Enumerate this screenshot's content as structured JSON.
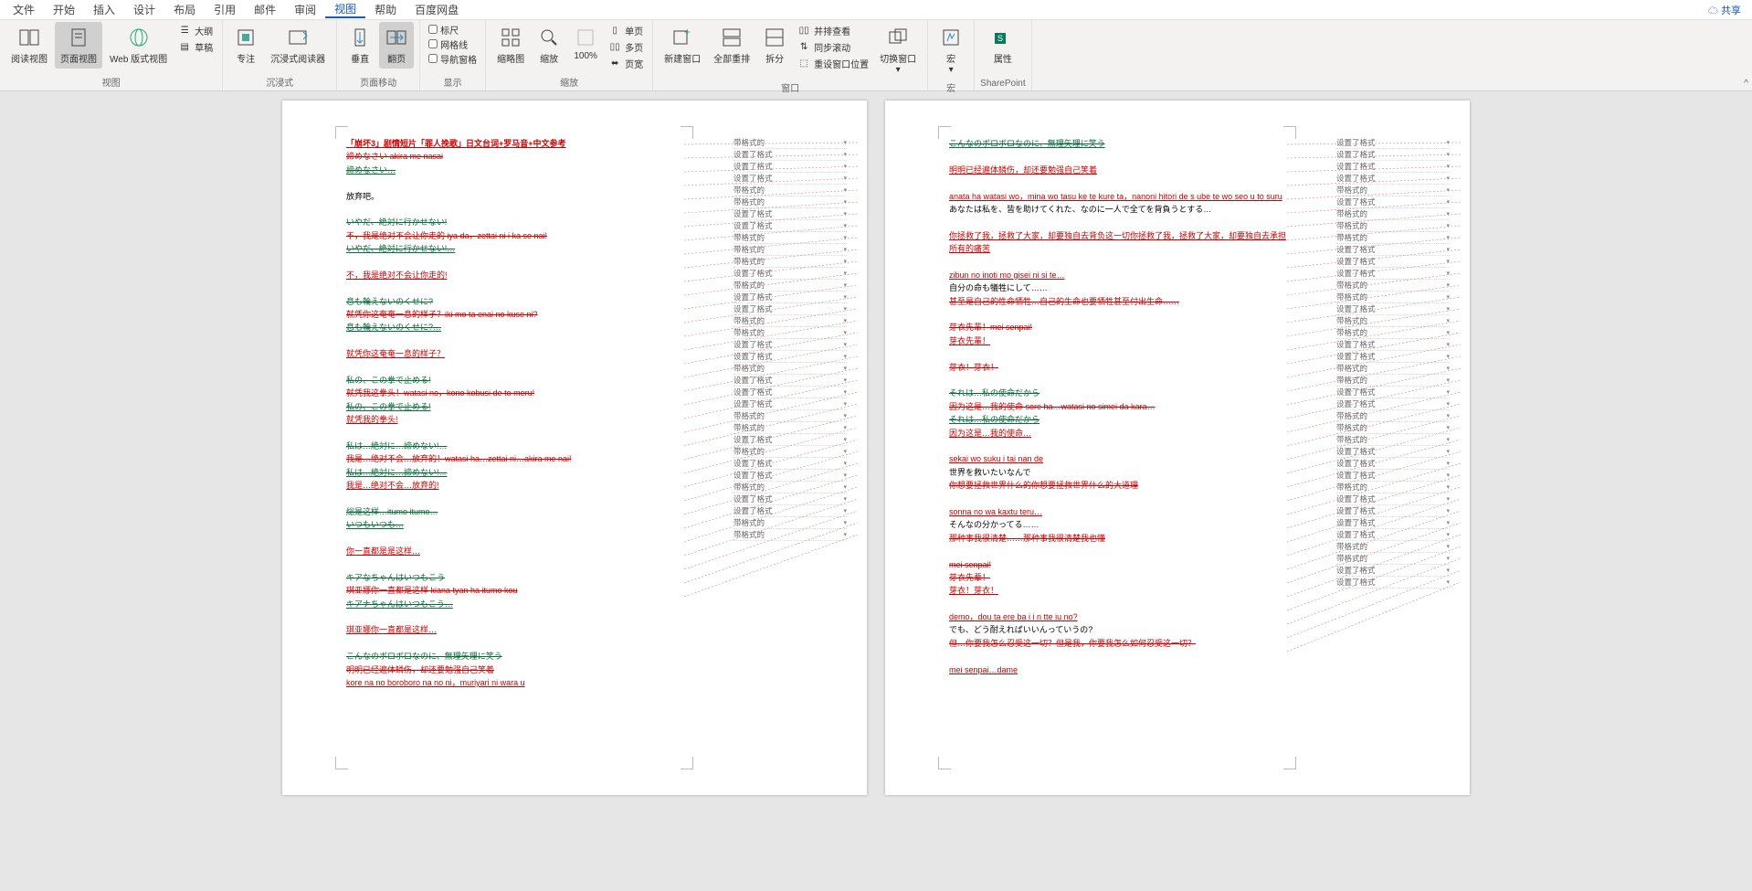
{
  "menu": {
    "items": [
      "文件",
      "开始",
      "插入",
      "设计",
      "布局",
      "引用",
      "邮件",
      "审阅",
      "视图",
      "帮助",
      "百度网盘"
    ],
    "active": 8,
    "share": "共享"
  },
  "ribbon": {
    "groups": [
      {
        "label": "视图",
        "btns": [
          {
            "n": "read",
            "t": "阅读视图"
          },
          {
            "n": "page",
            "t": "页面视图",
            "sel": true
          },
          {
            "n": "web",
            "t": "Web 版式视图"
          }
        ],
        "side": [
          {
            "n": "outline",
            "t": "大纲"
          },
          {
            "n": "draft",
            "t": "草稿"
          }
        ]
      },
      {
        "label": "沉浸式",
        "btns": [
          {
            "n": "focus",
            "t": "专注"
          },
          {
            "n": "reader",
            "t": "沉浸式阅读器"
          }
        ]
      },
      {
        "label": "页面移动",
        "btns": [
          {
            "n": "vert",
            "t": "垂直"
          },
          {
            "n": "flip",
            "t": "翻页",
            "sel": true
          }
        ]
      },
      {
        "label": "显示",
        "checks": [
          {
            "n": "ruler",
            "t": "标尺"
          },
          {
            "n": "grid",
            "t": "网格线"
          },
          {
            "n": "nav",
            "t": "导航窗格"
          }
        ]
      },
      {
        "label": "缩放",
        "btns": [
          {
            "n": "thumb",
            "t": "缩略图"
          },
          {
            "n": "zoom",
            "t": "缩放"
          },
          {
            "n": "z100",
            "t": "100%"
          }
        ],
        "side": [
          {
            "n": "onep",
            "t": "单页"
          },
          {
            "n": "multip",
            "t": "多页"
          },
          {
            "n": "pagew",
            "t": "页宽"
          }
        ]
      },
      {
        "label": "窗口",
        "btns": [
          {
            "n": "newwin",
            "t": "新建窗口"
          },
          {
            "n": "arrange",
            "t": "全部重排"
          },
          {
            "n": "split",
            "t": "拆分"
          }
        ],
        "side": [
          {
            "n": "sidebyside",
            "t": "并排查看"
          },
          {
            "n": "syncscroll",
            "t": "同步滚动"
          },
          {
            "n": "resetpos",
            "t": "重设窗口位置"
          }
        ],
        "extra": [
          {
            "n": "switch",
            "t": "切换窗口"
          }
        ]
      },
      {
        "label": "宏",
        "btns": [
          {
            "n": "macro",
            "t": "宏"
          }
        ]
      },
      {
        "label": "SharePoint",
        "btns": [
          {
            "n": "props",
            "t": "属性"
          }
        ]
      }
    ]
  },
  "revisions": {
    "fmt": "带格式的",
    "setfmt": "设置了格式"
  },
  "page1": {
    "title": "「崩坏3」剧情短片「罪人挽歌」日文台词+罗马音+中文参考",
    "lines": [
      {
        "c": "red del",
        "t": "諦めなさい akira me nasai"
      },
      {
        "c": "grn",
        "t": "諦めなさい…"
      },
      {
        "c": "blk",
        "t": ""
      },
      {
        "c": "blk",
        "t": "放弃吧。"
      },
      {
        "c": "blk",
        "t": ""
      },
      {
        "c": "grn del",
        "t": "いやだ、絶対に行かせない!"
      },
      {
        "c": "red del",
        "t": "不，我是绝对不会让你走的 iya da，zettai ni i ka se nai!"
      },
      {
        "c": "grn",
        "t": "いやだ、絶対に行かせない!…"
      },
      {
        "c": "blk",
        "t": ""
      },
      {
        "c": "red",
        "t": "不，我是绝对不会让你走的!"
      },
      {
        "c": "blk",
        "t": ""
      },
      {
        "c": "grn del",
        "t": "息も輪えないのくせに?"
      },
      {
        "c": "red del",
        "t": "就凭你这奄奄一息的样子？iki mo ta enai no kuse ni?"
      },
      {
        "c": "grn",
        "t": "息も輪えないのくせに?…"
      },
      {
        "c": "blk",
        "t": ""
      },
      {
        "c": "red",
        "t": "就凭你这奄奄一息的样子？"
      },
      {
        "c": "blk",
        "t": ""
      },
      {
        "c": "grn del",
        "t": "私の、この拳で止める!"
      },
      {
        "c": "red del",
        "t": "就凭我这拳头！watasi no，kono kobusi de to meru!"
      },
      {
        "c": "grn",
        "t": "私の、この拳で止める!"
      },
      {
        "c": "red",
        "t": "就凭我的拳头!"
      },
      {
        "c": "blk",
        "t": ""
      },
      {
        "c": "grn del",
        "t": "私は…絶対に…諦めない!…"
      },
      {
        "c": "red del",
        "t": "我是…绝对不会…放弃的！watasi ha…zettai ni…akira me nai!"
      },
      {
        "c": "grn",
        "t": "私は…絶対に…諦めない!…"
      },
      {
        "c": "red",
        "t": "我是…绝对不会…放弃的!"
      },
      {
        "c": "blk",
        "t": ""
      },
      {
        "c": "grn del",
        "t": "総是这样…itumo itumo…"
      },
      {
        "c": "grn",
        "t": "いつもいつも…"
      },
      {
        "c": "blk",
        "t": ""
      },
      {
        "c": "red",
        "t": "你一直都是是这样…"
      },
      {
        "c": "blk",
        "t": ""
      },
      {
        "c": "grn del",
        "t": "キアなちゃんはいつもこう"
      },
      {
        "c": "red del",
        "t": "琪亚娜你一直都是这样 kiana tyan ha itumo kou"
      },
      {
        "c": "grn",
        "t": "キアナちゃんはいつもこう…"
      },
      {
        "c": "blk",
        "t": ""
      },
      {
        "c": "red",
        "t": "琪亚娜你一直都是这样…"
      },
      {
        "c": "blk",
        "t": ""
      },
      {
        "c": "grn del",
        "t": "こんなのボロボロなのに、無理矢理に笑う"
      },
      {
        "c": "red del",
        "t": "明明已经遍体鳞伤，却还要勉强自己笑着"
      },
      {
        "c": "red",
        "t": "kore na no boroboro na no ni，muriyari ni wara u"
      }
    ],
    "revs": [
      "fmt",
      "setfmt",
      "setfmt",
      "setfmt",
      "fmt",
      "fmt",
      "setfmt",
      "setfmt",
      "fmt",
      "fmt",
      "fmt",
      "setfmt",
      "fmt",
      "setfmt",
      "setfmt",
      "fmt",
      "fmt",
      "setfmt",
      "setfmt",
      "fmt",
      "setfmt",
      "setfmt",
      "setfmt",
      "fmt",
      "fmt",
      "setfmt",
      "fmt",
      "setfmt",
      "setfmt",
      "fmt",
      "setfmt",
      "setfmt",
      "fmt",
      "fmt"
    ]
  },
  "page2": {
    "lines": [
      {
        "c": "grn",
        "t": "こんなのボロボロなのに、無理矢理に笑う"
      },
      {
        "c": "blk",
        "t": ""
      },
      {
        "c": "red",
        "t": "明明已经遍体鳞伤，却还要勉强自己笑着"
      },
      {
        "c": "blk",
        "t": ""
      },
      {
        "c": "red",
        "t": "anata ha watasi wo，mina wo tasu ke te kure ta，nanoni hitori de s ube te wo seo u to suru"
      },
      {
        "c": "blk",
        "t": "あなたは私を、皆を助けてくれた、なのに一人で全てを背負うとする…"
      },
      {
        "c": "blk",
        "t": ""
      },
      {
        "c": "red",
        "t": "你拯救了我，拯救了大家，却要独自去背负这一切你拯救了我，拯救了大家，却要独自去承担所有的痛苦"
      },
      {
        "c": "blk",
        "t": ""
      },
      {
        "c": "red",
        "t": "zibun no inoti mo gisei ni si te…"
      },
      {
        "c": "blk",
        "t": "自分の命も犠牲にして……"
      },
      {
        "c": "red del",
        "t": "甚至是自己的性命牺牲…自己的生命也要牺牲甚至付出生命……"
      },
      {
        "c": "blk",
        "t": ""
      },
      {
        "c": "red del",
        "t": "芽衣先輩！mei senpai!"
      },
      {
        "c": "red",
        "t": "芽衣先輩！"
      },
      {
        "c": "blk",
        "t": ""
      },
      {
        "c": "red del",
        "t": "芽衣！芽衣！"
      },
      {
        "c": "blk",
        "t": ""
      },
      {
        "c": "grn del",
        "t": "それは…私の使命だから"
      },
      {
        "c": "red del",
        "t": "因为这是…我的使命 sore ha…watasi no simei da kara…"
      },
      {
        "c": "grn",
        "t": "それは…私の使命だから"
      },
      {
        "c": "red",
        "t": "因为这是…我的使命…"
      },
      {
        "c": "blk",
        "t": ""
      },
      {
        "c": "red",
        "t": "sekai wo suku i tai nan de"
      },
      {
        "c": "blk",
        "t": "世界を救いたいなんで"
      },
      {
        "c": "red del",
        "t": "你想要拯救世界什么的你想要拯救世界什么的大道理"
      },
      {
        "c": "blk",
        "t": ""
      },
      {
        "c": "red",
        "t": "sonna no wa kaxtu teru…"
      },
      {
        "c": "blk",
        "t": "そんなの分かってる……"
      },
      {
        "c": "red del",
        "t": "那种事我很清楚……那种事我很清楚我也懂"
      },
      {
        "c": "blk",
        "t": ""
      },
      {
        "c": "red del",
        "t": "mei senpai!"
      },
      {
        "c": "red del",
        "t": "芽衣先辈！"
      },
      {
        "c": "red",
        "t": "芽衣！芽衣！"
      },
      {
        "c": "blk",
        "t": ""
      },
      {
        "c": "red",
        "t": "demo，dou ta ere ba i i n tte iu no?"
      },
      {
        "c": "blk",
        "t": "でも、どう耐えればいいんっていうの?"
      },
      {
        "c": "red del",
        "t": "但…你要我怎么忍受这一切？但是我，你要我怎么如何忍受这一切？"
      },
      {
        "c": "blk",
        "t": ""
      },
      {
        "c": "red",
        "t": "mei senpai…dame"
      }
    ],
    "revs": [
      "setfmt",
      "setfmt",
      "setfmt",
      "setfmt",
      "fmt",
      "setfmt",
      "fmt",
      "fmt",
      "fmt",
      "setfmt",
      "setfmt",
      "setfmt",
      "fmt",
      "fmt",
      "setfmt",
      "fmt",
      "fmt",
      "setfmt",
      "setfmt",
      "fmt",
      "fmt",
      "setfmt",
      "setfmt",
      "fmt",
      "fmt",
      "fmt",
      "setfmt",
      "setfmt",
      "setfmt",
      "fmt",
      "setfmt",
      "setfmt",
      "setfmt",
      "setfmt",
      "fmt",
      "fmt",
      "setfmt",
      "setfmt"
    ]
  }
}
